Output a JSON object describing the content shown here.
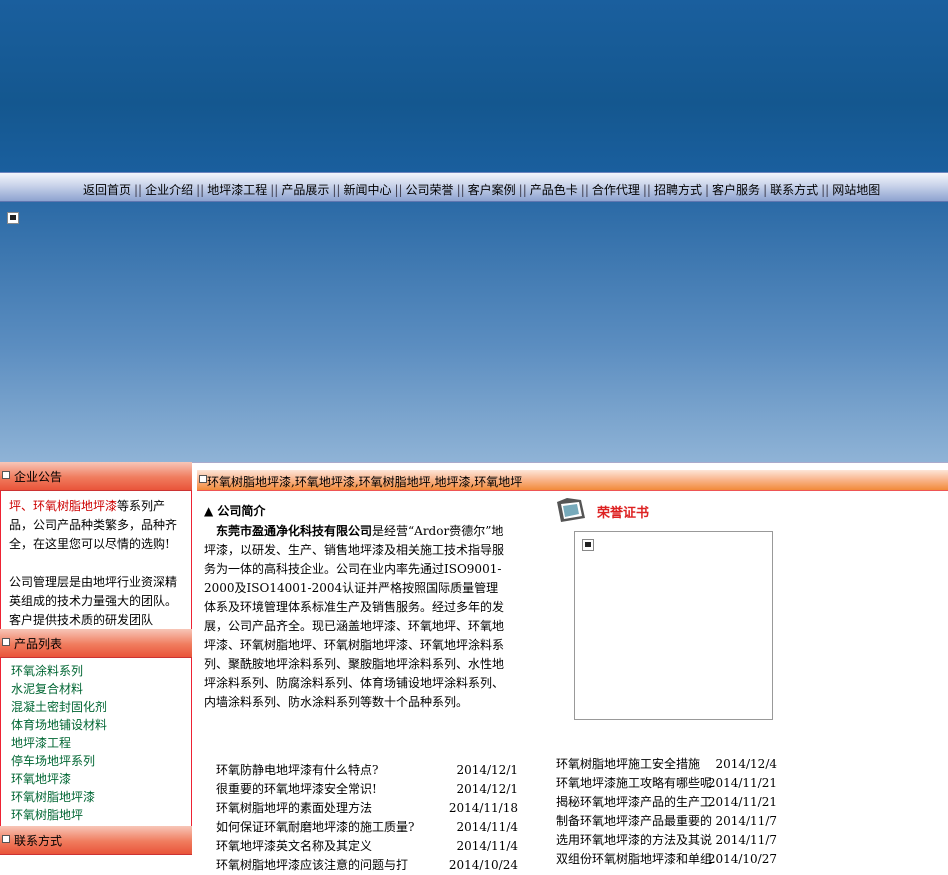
{
  "nav": {
    "items": [
      "返回首页",
      "企业介绍",
      "地坪漆工程",
      "产品展示",
      "新闻中心",
      "公司荣誉",
      "客户案例",
      "产品色卡",
      "合作代理",
      "招聘方式",
      "客户服务",
      "联系方式",
      "网站地图"
    ]
  },
  "sidebar": {
    "notice_title": "企业公告",
    "notice_lead_red": "坪、环氧树脂地坪漆",
    "notice_lead_rest": "等系列产品，公司产品种类繁多，品种齐全，在这里您可以尽情的选购!",
    "notice_p2": "公司管理层是由地坪行业资深精英组成的技术力量强大的团队。",
    "notice_p3": "客户提供技术质的研发团队",
    "products_title": "产品列表",
    "products": [
      "环氧涂料系列",
      "水泥复合材料",
      "混凝土密封固化剂",
      "体育场地铺设材料",
      "地坪漆工程",
      "停车场地坪系列",
      "环氧地坪漆",
      "环氧树脂地坪漆",
      "环氧树脂地坪"
    ],
    "contact_title": "联系方式"
  },
  "main": {
    "bar_title": "环氧树脂地坪漆,环氧地坪漆,环氧树脂地坪,地坪漆,环氧地坪",
    "intro_title": "▲ 公司简介",
    "company_name": "东莞市盈通净化科技有限公司",
    "intro_body": "是经营“Ardor赍德尔”地坪漆，以研发、生产、销售地坪漆及相关施工技术指导服务为一体的高科技企业。公司在业内率先通过ISO9001-2000及ISO14001-2004认证并严格按照国际质量管理体系及环境管理体系标准生产及销售服务。经过多年的发展，公司产品齐全。现已涵盖地坪漆、环氧地坪、环氧地坪漆、环氧树脂地坪、环氧树脂地坪漆、环氧地坪涂料系列、聚酰胺地坪涂料系列、聚胺脂地坪涂料系列、水性地坪涂料系列、防腐涂料系列、体育场铺设地坪涂料系列、内墙涂料系列、防水涂料系列等数十个品种系列。",
    "cert_title": "荣誉证书"
  },
  "news_left": [
    {
      "title": "环氧防静电地坪漆有什么特点?",
      "date": "2014/12/1"
    },
    {
      "title": "很重要的环氧地坪漆安全常识!",
      "date": "2014/12/1"
    },
    {
      "title": "环氧树脂地坪的素面处理方法",
      "date": "2014/11/18"
    },
    {
      "title": "如何保证环氧耐磨地坪漆的施工质量?",
      "date": "2014/11/4"
    },
    {
      "title": "环氧地坪漆英文名称及其定义",
      "date": "2014/11/4"
    },
    {
      "title": "环氧树脂地坪漆应该注意的问题与打",
      "date": "2014/10/24"
    }
  ],
  "news_right": [
    {
      "title": "环氧树脂地坪施工安全措施",
      "date": "2014/12/4"
    },
    {
      "title": "环氧地坪漆施工攻略有哪些呢",
      "date": "2014/11/21"
    },
    {
      "title": "揭秘环氧地坪漆产品的生产工",
      "date": "2014/11/21"
    },
    {
      "title": "制备环氧地坪漆产品最重要的",
      "date": "2014/11/7"
    },
    {
      "title": "选用环氧地坪漆的方法及其说",
      "date": "2014/11/7"
    },
    {
      "title": "双组份环氧树脂地坪漆和单组",
      "date": "2014/10/27"
    }
  ]
}
